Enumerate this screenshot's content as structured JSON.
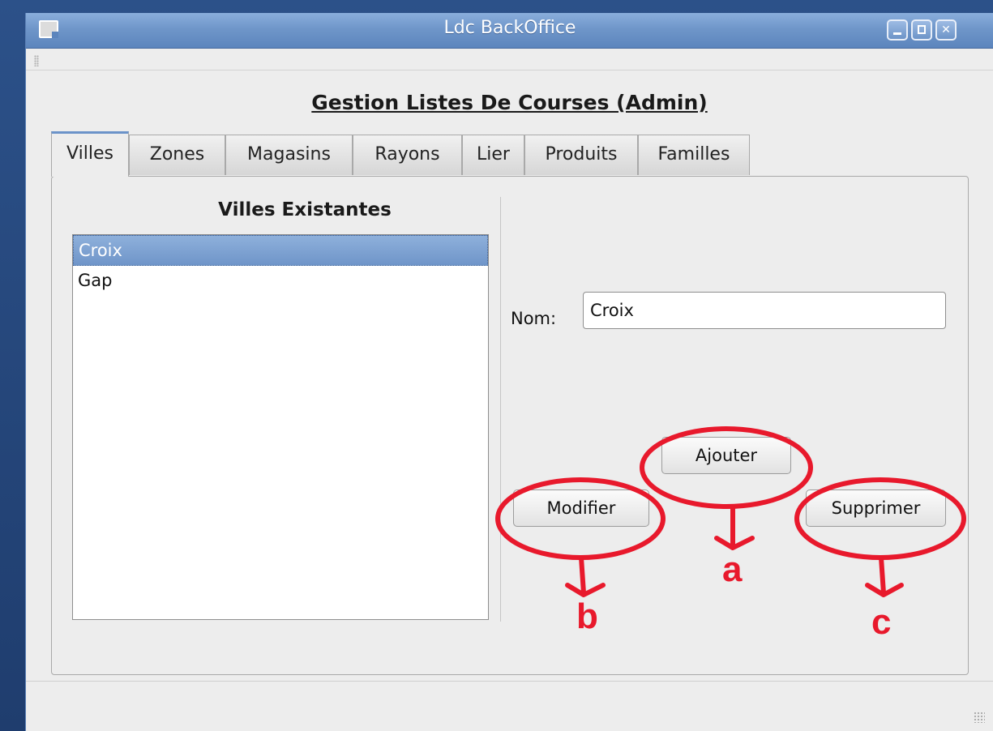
{
  "window": {
    "title": "Ldc BackOffice"
  },
  "page": {
    "heading": "Gestion Listes De Courses (Admin)"
  },
  "tabs": [
    {
      "label": "Villes",
      "active": true
    },
    {
      "label": "Zones",
      "active": false
    },
    {
      "label": "Magasins",
      "active": false
    },
    {
      "label": "Rayons",
      "active": false
    },
    {
      "label": "Lier",
      "active": false
    },
    {
      "label": "Produits",
      "active": false
    },
    {
      "label": "Familles",
      "active": false
    }
  ],
  "villes": {
    "title": "Villes Existantes",
    "items": [
      {
        "label": "Croix",
        "selected": true
      },
      {
        "label": "Gap",
        "selected": false
      }
    ]
  },
  "form": {
    "nom_label": "Nom:",
    "nom_value": "Croix"
  },
  "buttons": {
    "ajouter": "Ajouter",
    "modifier": "Modifier",
    "supprimer": "Supprimer"
  },
  "annotations": {
    "color": "#e8192c",
    "labels": [
      "a",
      "b",
      "c"
    ]
  },
  "colors": {
    "titlebar": "#6f96c9",
    "selection": "#7a9fd1",
    "window_bg": "#ededed"
  }
}
